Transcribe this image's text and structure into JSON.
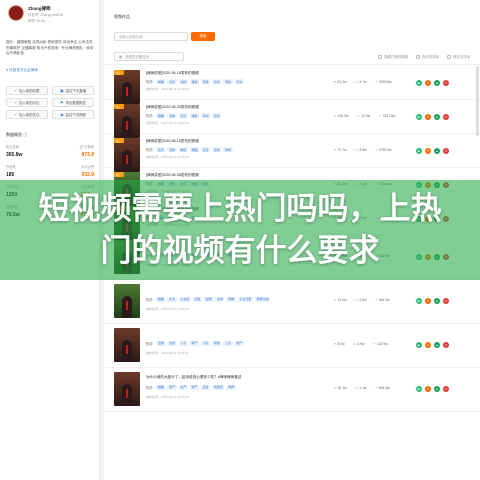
{
  "profile": {
    "name": "Zhang律师",
    "meta": "抖音号: Zhanglvshi916",
    "meta2": "获赞 10.8w",
    "bio": "擅长：婚姻家庭 合同纠纷 债权债务 劳动争议 公司法务 刑事辩护 交通事故 知识产权咨询 · 专业律师团队 · 商务合作请私信",
    "verified": "● 抖音官方认证律师"
  },
  "actions": [
    {
      "icon": "+",
      "label": "加入我的收藏"
    },
    {
      "icon": "▣",
      "label": "监控下次直播"
    },
    {
      "icon": "+",
      "label": "加入我的对比"
    },
    {
      "icon": "⚑",
      "label": "导出数据报告"
    },
    {
      "icon": "+",
      "label": "加入我的关注"
    },
    {
      "icon": "◉",
      "label": "监控下次视频"
    }
  ],
  "stats": {
    "title": "数据概览 ⓘ",
    "groups": [
      {
        "l1": "粉丝总量",
        "v1": "365.8w",
        "l2": "近7日新增",
        "v2": "873.9"
      },
      {
        "l1": "作品数",
        "v1": "185",
        "l2": "平均点赞",
        "v2": "932.9"
      },
      {
        "l1": "平均评论",
        "v1": "1250",
        "l2": "平均转发",
        "v2": "12.5w"
      },
      {
        "l1": "直播场次",
        "v1": "75.5w",
        "l2": "带货数量",
        "v2": "97.1w"
      }
    ]
  },
  "main": {
    "title": "视频作品",
    "search_placeholder": "请输入视频标题",
    "search_button": "搜索",
    "date_placeholder": "请选择日期区间",
    "filters": [
      "隐藏已删除视频",
      "按点赞排序",
      "按评论排序"
    ]
  },
  "videos": [
    {
      "badge": "热门",
      "title": "[律师讲堂]2020-05-18发布的视频",
      "tags": [
        "婚姻",
        "合同",
        "法律",
        "维权",
        "离婚",
        "债务",
        "劳动",
        "普法"
      ],
      "time": "发布时间：2020-05-18 12:30:21",
      "likes": "61.3w",
      "comments": "3.7w",
      "shares": "3292.8w"
    },
    {
      "badge": "热门",
      "title": "[律师讲堂]2020-06-30发布的视频",
      "tags": [
        "婚姻",
        "法律",
        "合同",
        "维权",
        "劳动",
        "债务"
      ],
      "time": "发布时间：2020-06-30 18:20:45",
      "likes": "109.9w",
      "comments": "12.9w",
      "shares": "3227.8w"
    },
    {
      "badge": "热门",
      "title": "[律师讲堂]2020-06-16发布的视频",
      "tags": [
        "合同",
        "法律",
        "维权",
        "婚姻",
        "普法",
        "咨询",
        "律师"
      ],
      "time": "发布时间：2020-06-16 10:15:36",
      "likes": "70.7w",
      "comments": "3.5w",
      "shares": "1763.3w"
    },
    {
      "badge": "热门",
      "title": "[律师讲堂]2020-06-08发布的视频",
      "tags": [
        "婚姻",
        "法律",
        "合同",
        "维权",
        "债务"
      ],
      "time": "发布时间：2020-06-08 09:12:18",
      "likes": "82.4w",
      "comments": "5.1w",
      "shares": "2156.4w"
    },
    {
      "badge": "热门",
      "title": "[律师讲堂]2020-05-30发布的视频",
      "tags": [
        "法律",
        "维权",
        "普法",
        "咨询"
      ],
      "time": "发布时间：2020-05-30 16:42:09",
      "likes": "45.8w",
      "comments": "2.6w",
      "shares": "986.5w"
    },
    {
      "badge": "",
      "title": "",
      "tags": [
        "男人",
        "女人",
        "财产",
        "婚姻",
        "离婚证",
        "律师",
        "离婚"
      ],
      "time": "发布时间：2020-06-03 10:55:04",
      "likes": "17.9w",
      "comments": "3.3w",
      "shares": "542.8w"
    },
    {
      "badge": "",
      "title": "",
      "tags": [
        "婚姻",
        "女方",
        "子女权",
        "出轨",
        "配偶",
        "法律",
        "离婚",
        "子女归属",
        "离婚冷静"
      ],
      "time": "发布时间：2020-06-10 14:20:36",
      "likes": "19.6w",
      "comments": "3.0w",
      "shares": "951.9w"
    },
    {
      "badge": "",
      "title": "",
      "tags": [
        "法律",
        "法官",
        "儿子",
        "财产",
        "子女",
        "离婚",
        "儿子",
        "财产"
      ],
      "time": "发布时间：2020-06-18 18:25:11",
      "likes": "8.0w",
      "comments": "6.9w",
      "shares": "130.9w"
    },
    {
      "badge": "",
      "title": "为什么他的大部分了，起诉收到公婆多少吃？#律师律师普法",
      "tags": [
        "婚姻",
        "财产",
        "资产",
        "财产",
        "起诉",
        "离婚证",
        "律师"
      ],
      "time": "发布时间：2020-06-24 09:30:48",
      "likes": "16.1w",
      "comments": "1.1w",
      "shares": "801.5w"
    }
  ],
  "overlay": {
    "line1": "短视频需要上热门吗吗，上热",
    "line2": "门的视频有什么要求"
  }
}
